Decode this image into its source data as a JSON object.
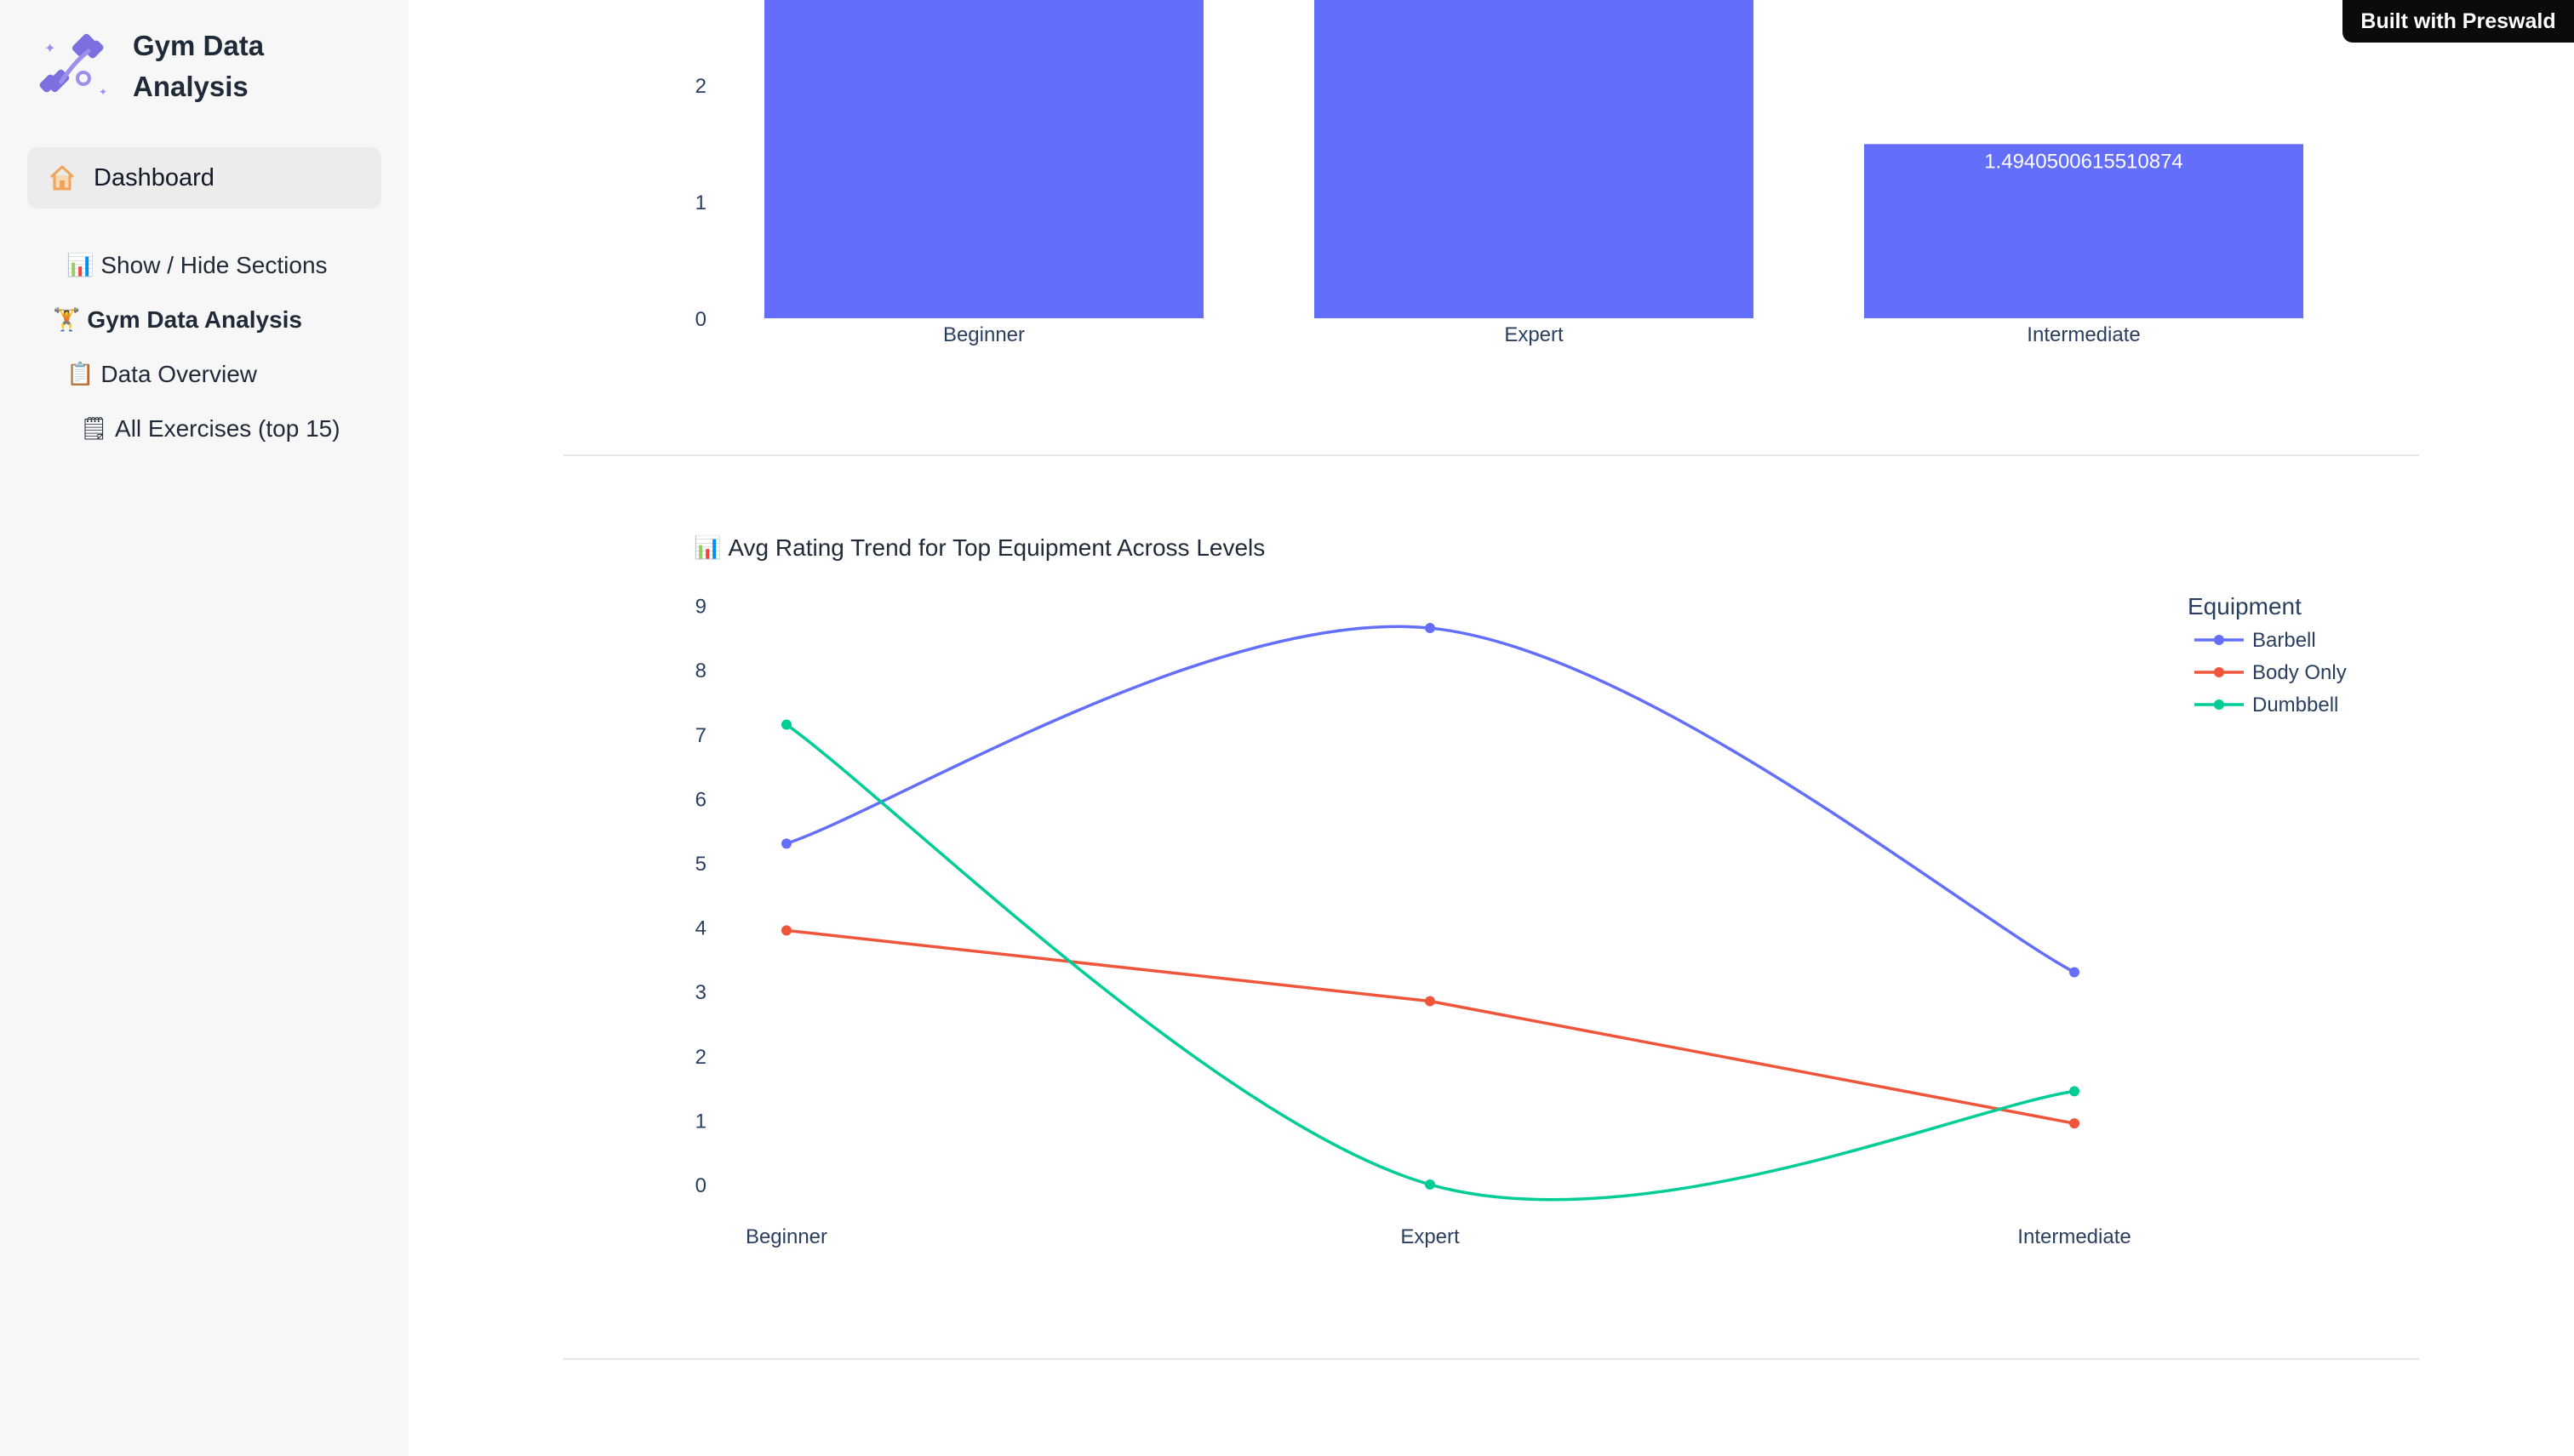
{
  "app": {
    "title": "Gym Data Analysis",
    "badge": "Built with Preswald"
  },
  "sidebar": {
    "active": {
      "label": "Dashboard",
      "icon": "home-icon"
    },
    "toc": [
      {
        "emoji": "📊",
        "label": "Show / Hide Sections"
      },
      {
        "emoji": "🏋",
        "label": "Gym Data Analysis"
      },
      {
        "emoji": "📋",
        "label": "Data Overview"
      },
      {
        "emoji": "🗒",
        "label": "All Exercises (top 15)"
      }
    ]
  },
  "chart_data": [
    {
      "type": "bar",
      "categories": [
        "Beginner",
        "Expert",
        "Intermediate"
      ],
      "values": [
        null,
        null,
        1.4940500615510874
      ],
      "data_labels": [
        "",
        "",
        "1.4940500615510874"
      ],
      "y_ticks": [
        "0",
        "1",
        "2"
      ],
      "ylim": [
        0,
        2.75
      ],
      "color": "#636efa",
      "note_partial": "Beginner and Expert bars extend past the visible top of the viewport"
    },
    {
      "type": "line",
      "title_emoji": "📊",
      "title": "Avg Rating Trend for Top Equipment Across Levels",
      "categories": [
        "Beginner",
        "Expert",
        "Intermediate"
      ],
      "y_ticks": [
        "0",
        "1",
        "2",
        "3",
        "4",
        "5",
        "6",
        "7",
        "8",
        "9"
      ],
      "ylim": [
        0,
        9
      ],
      "legend_title": "Equipment",
      "legend_position": "top-right",
      "series": [
        {
          "name": "Barbell",
          "values": [
            5.3,
            8.65,
            3.3
          ],
          "color": "#636efa"
        },
        {
          "name": "Body Only",
          "values": [
            3.95,
            2.85,
            0.95
          ],
          "color": "#ef553b"
        },
        {
          "name": "Dumbbell",
          "values": [
            7.15,
            0.0,
            1.45
          ],
          "color": "#00cc96"
        }
      ]
    }
  ]
}
